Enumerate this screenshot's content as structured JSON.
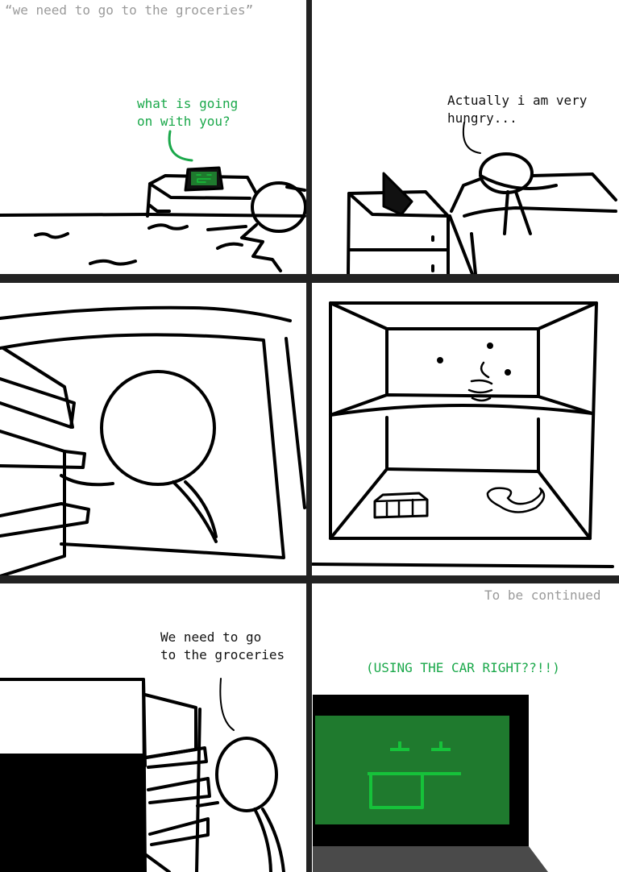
{
  "panels": {
    "p1": {
      "caption": "“we need to go to the groceries”",
      "speech": "what is going\non with you?"
    },
    "p2": {
      "speech": "Actually i am very\nhungry..."
    },
    "p5": {
      "speech": "We need to go\nto the groceries"
    },
    "p6": {
      "caption": "To be continued",
      "speech": "(USING THE CAR RIGHT??!!)"
    }
  },
  "colors": {
    "ink": "#000000",
    "gutter": "#222222",
    "robot_screen": "#1f7a2e",
    "robot_face": "#16c23a",
    "speech_green": "#1aa84a",
    "caption_gray": "#9a9a9a"
  }
}
